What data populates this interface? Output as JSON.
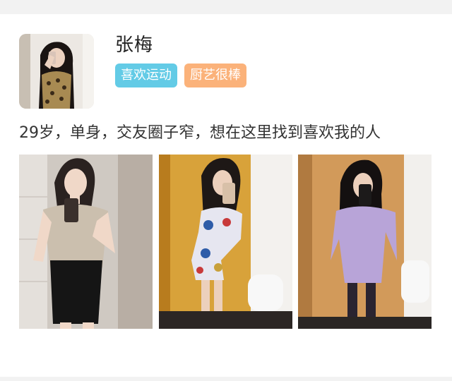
{
  "profile": {
    "name": "张梅",
    "tags": [
      "喜欢运动",
      "厨艺很棒"
    ],
    "bio": "29岁，单身，交友圈子窄，想在这里找到喜欢我的人"
  },
  "colors": {
    "tag_blue": "#63cbe6",
    "tag_orange": "#fbb27a",
    "page_background": "#f2f2f2"
  }
}
